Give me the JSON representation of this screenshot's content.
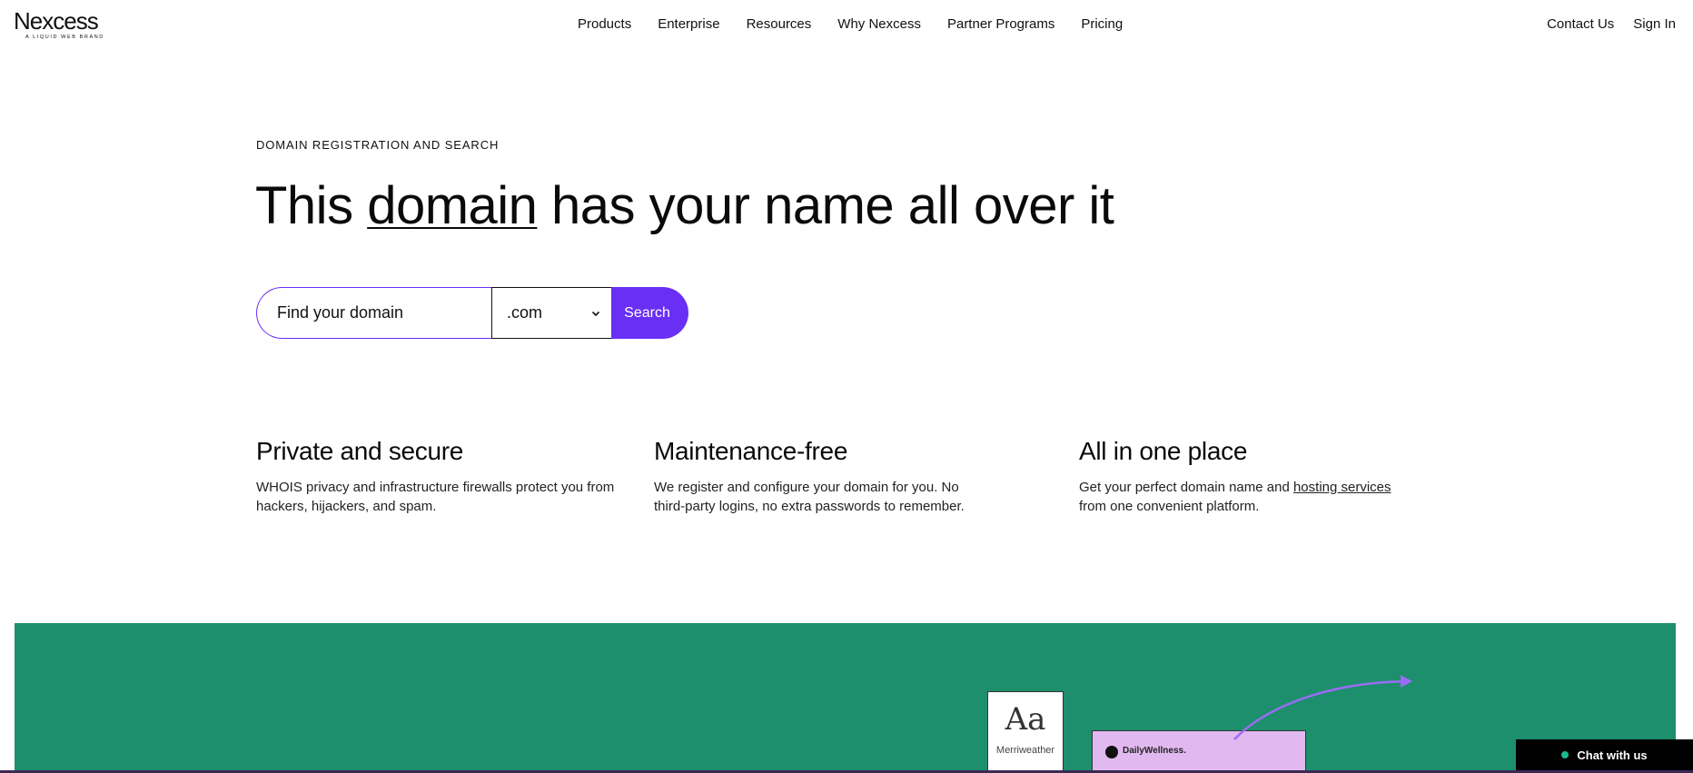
{
  "brand": {
    "name": "Nexcess",
    "tagline": "A LIQUID WEB BRAND"
  },
  "nav": {
    "items": [
      {
        "label": "Products"
      },
      {
        "label": "Enterprise"
      },
      {
        "label": "Resources"
      },
      {
        "label": "Why Nexcess"
      },
      {
        "label": "Partner Programs"
      },
      {
        "label": "Pricing"
      }
    ],
    "contact": "Contact Us",
    "signin": "Sign In"
  },
  "hero": {
    "eyebrow": "DOMAIN REGISTRATION AND SEARCH",
    "title_before": "This ",
    "title_underlined": "domain",
    "title_after": " has your name all over it"
  },
  "search": {
    "placeholder": "Find your domain",
    "tld_selected": ".com",
    "button_label": "Search"
  },
  "features": [
    {
      "title": "Private and secure",
      "body": "WHOIS privacy and infrastructure firewalls protect you from hackers, hijackers, and spam."
    },
    {
      "title": "Maintenance-free",
      "body": "We register and configure your domain for you. No third-party logins, no extra passwords to remember."
    },
    {
      "title": "All in one place",
      "body_before": "Get your perfect domain name and ",
      "link": "hosting services",
      "body_after": " from one convenient platform."
    }
  ],
  "banner": {
    "font_sample": "Aa",
    "font_name": "Merriweather",
    "site_name": "DailyWellness."
  },
  "chat": {
    "label": "Chat with us"
  },
  "colors": {
    "accent": "#6a2ff5",
    "banner_green": "#1d8f6c",
    "card_pink": "#e1b8ef",
    "chat_bg": "#000000",
    "status_green": "#1db98a"
  },
  "icons": [
    "chevron-down-icon",
    "arrow-icon",
    "status-dot-icon"
  ]
}
